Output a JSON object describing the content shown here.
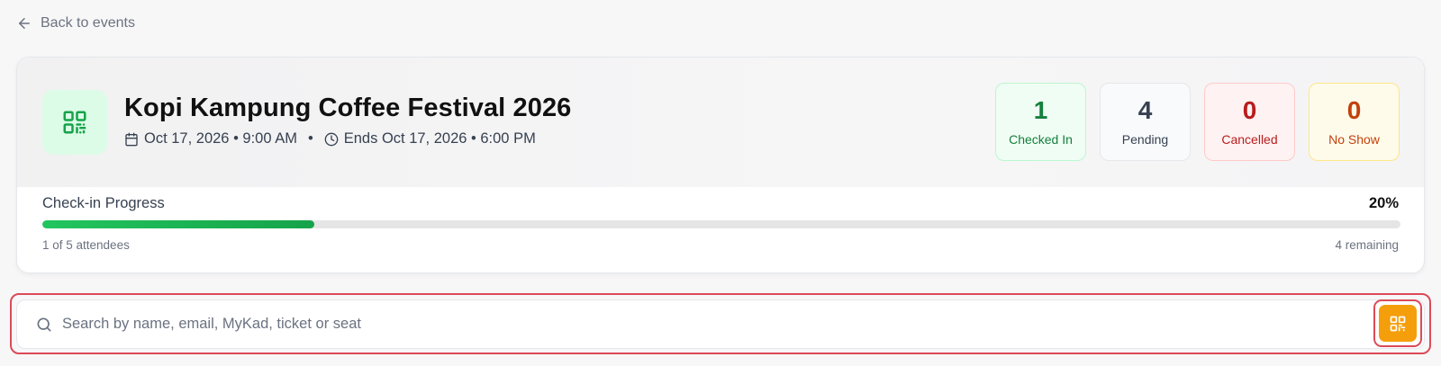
{
  "nav": {
    "back_label": "Back to events"
  },
  "event": {
    "title": "Kopi Kampung Coffee Festival 2026",
    "start": "Oct 17, 2026 • 9:00 AM",
    "separator": "•",
    "end": "Ends Oct 17, 2026 • 6:00 PM",
    "icon": "qr-code-icon"
  },
  "stats": {
    "checked_in": {
      "value": "1",
      "label": "Checked In",
      "color": "#15803d"
    },
    "pending": {
      "value": "4",
      "label": "Pending",
      "color": "#374151"
    },
    "cancelled": {
      "value": "0",
      "label": "Cancelled",
      "color": "#b91c1c"
    },
    "no_show": {
      "value": "0",
      "label": "No Show",
      "color": "#c2410c"
    }
  },
  "progress": {
    "label": "Check-in Progress",
    "percent_label": "20%",
    "fraction": 0.2,
    "attendees_text": "1 of 5 attendees",
    "remaining_text": "4 remaining"
  },
  "search": {
    "placeholder": "Search by name, email, MyKad, ticket or seat",
    "value": "",
    "scan_button_icon": "qr-scan-icon",
    "accent_color": "#f59e0b"
  }
}
